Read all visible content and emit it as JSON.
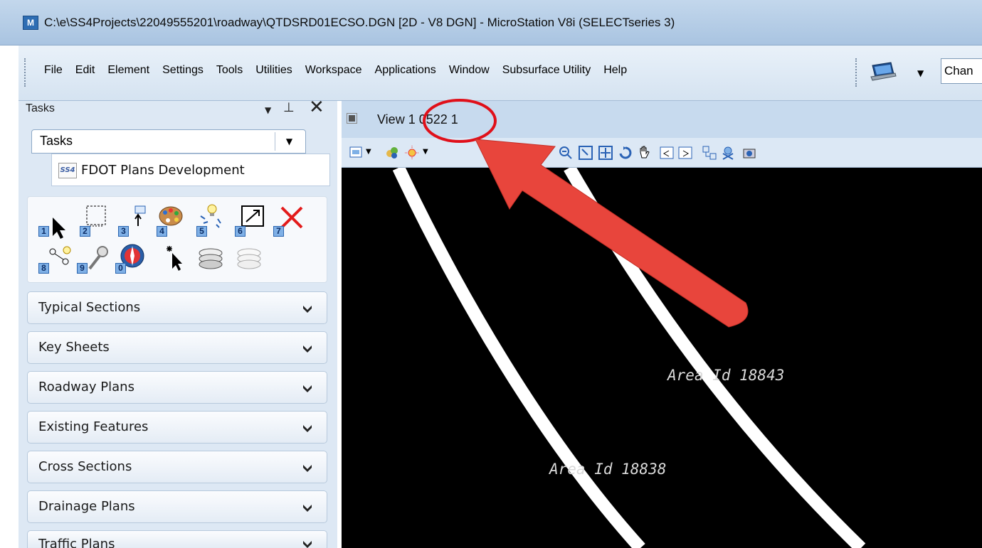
{
  "window": {
    "title": "C:\\e\\SS4Projects\\22049555201\\roadway\\QTDSRD01ECSO.DGN [2D - V8 DGN] - MicroStation V8i (SELECTseries 3)"
  },
  "menu": {
    "items": [
      "File",
      "Edit",
      "Element",
      "Settings",
      "Tools",
      "Utilities",
      "Workspace",
      "Applications",
      "Window",
      "Subsurface Utility",
      "Help"
    ],
    "toolbar_box_text": "Chan"
  },
  "tasks_panel": {
    "header": "Tasks",
    "combo_label": "Tasks",
    "workflow": "FDOT Plans Development",
    "tool_numbers": [
      "1",
      "2",
      "3",
      "4",
      "5",
      "6",
      "7",
      "8",
      "9",
      "0"
    ],
    "sections": [
      "Typical Sections",
      "Key Sheets",
      "Roadway Plans",
      "Existing Features",
      "Cross Sections",
      "Drainage Plans",
      "Traffic Plans"
    ]
  },
  "view": {
    "title": "View 1  0522 1",
    "labels": [
      "Area Id 18843",
      "Area Id 18838"
    ]
  },
  "annotation": {
    "arrow_color": "#e8453c",
    "circle_color": "#e0101a"
  },
  "colors": {
    "titlebar": "#b9cfe7",
    "panel": "#dde8f4",
    "canvas": "#000000",
    "lines": "#ffffff"
  }
}
